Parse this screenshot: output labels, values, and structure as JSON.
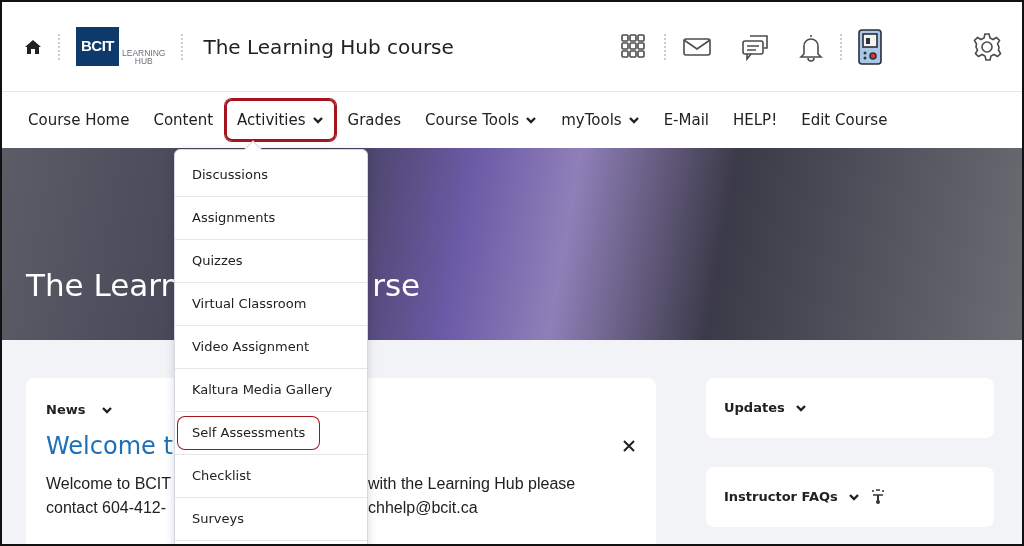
{
  "header": {
    "logo": {
      "brand": "BCIT",
      "line_1": "LEARNING",
      "line_2": "HUB"
    },
    "title": "The Learning Hub course"
  },
  "nav": [
    {
      "label": "Course Home",
      "dropdown": false,
      "highlighted": false
    },
    {
      "label": "Content",
      "dropdown": false,
      "highlighted": false
    },
    {
      "label": "Activities",
      "dropdown": true,
      "highlighted": true
    },
    {
      "label": "Grades",
      "dropdown": false,
      "highlighted": false
    },
    {
      "label": "Course Tools",
      "dropdown": true,
      "highlighted": false
    },
    {
      "label": "myTools",
      "dropdown": true,
      "highlighted": false
    },
    {
      "label": "E-Mail",
      "dropdown": false,
      "highlighted": false
    },
    {
      "label": "HELP!",
      "dropdown": false,
      "highlighted": false
    },
    {
      "label": "Edit Course",
      "dropdown": false,
      "highlighted": false
    }
  ],
  "activities_menu": [
    {
      "label": "Discussions",
      "highlighted": false
    },
    {
      "label": "Assignments",
      "highlighted": false
    },
    {
      "label": "Quizzes",
      "highlighted": false
    },
    {
      "label": "Virtual Classroom",
      "highlighted": false
    },
    {
      "label": "Video Assignment",
      "highlighted": false
    },
    {
      "label": "Kaltura Media Gallery",
      "highlighted": false
    },
    {
      "label": "Self Assessments",
      "highlighted": true
    },
    {
      "label": "Checklist",
      "highlighted": false
    },
    {
      "label": "Surveys",
      "highlighted": false
    }
  ],
  "banner": {
    "title_parts": [
      "The Learn",
      "rse"
    ]
  },
  "news": {
    "title": "News",
    "heading": "Welcome t",
    "body_lines": [
      [
        "Welcome to BCIT",
        "with the Learning Hub please"
      ],
      [
        "contact 604-412-",
        "chhelp@bcit.ca"
      ]
    ]
  },
  "widgets": [
    {
      "title": "Updates",
      "kind": "plain"
    },
    {
      "title": "Instructor FAQs",
      "kind": "with_icon"
    }
  ]
}
